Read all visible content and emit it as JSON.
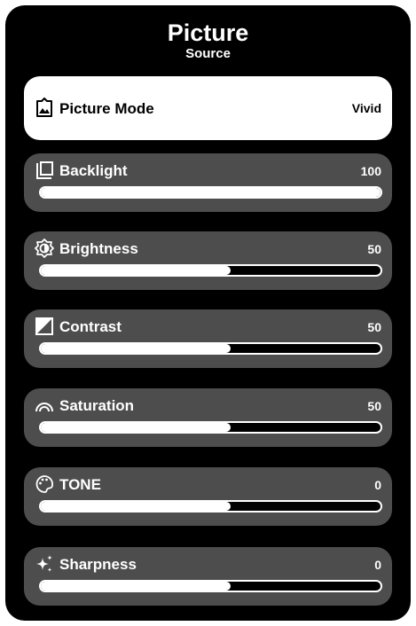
{
  "header": {
    "title": "Picture",
    "subtitle": "Source"
  },
  "picture_mode": {
    "label": "Picture Mode",
    "value": "Vivid",
    "icon": "picture-mode-icon"
  },
  "settings": [
    {
      "key": "backlight",
      "label": "Backlight",
      "value": "100",
      "level": 1.0,
      "icon": "backlight-icon"
    },
    {
      "key": "brightness",
      "label": "Brightness",
      "value": "50",
      "level": 0.56,
      "icon": "brightness-icon"
    },
    {
      "key": "contrast",
      "label": "Contrast",
      "value": "50",
      "level": 0.56,
      "icon": "contrast-icon"
    },
    {
      "key": "saturation",
      "label": "Saturation",
      "value": "50",
      "level": 0.56,
      "icon": "saturation-icon"
    },
    {
      "key": "tone",
      "label": "TONE",
      "value": "0",
      "level": 0.56,
      "icon": "tone-icon"
    },
    {
      "key": "sharpness",
      "label": "Sharpness",
      "value": "0",
      "level": 0.56,
      "icon": "sharpness-icon"
    }
  ],
  "colors": {
    "panel": "#000000",
    "row": "#4d4d4d",
    "selected_row": "#ffffff",
    "text": "#ffffff"
  }
}
